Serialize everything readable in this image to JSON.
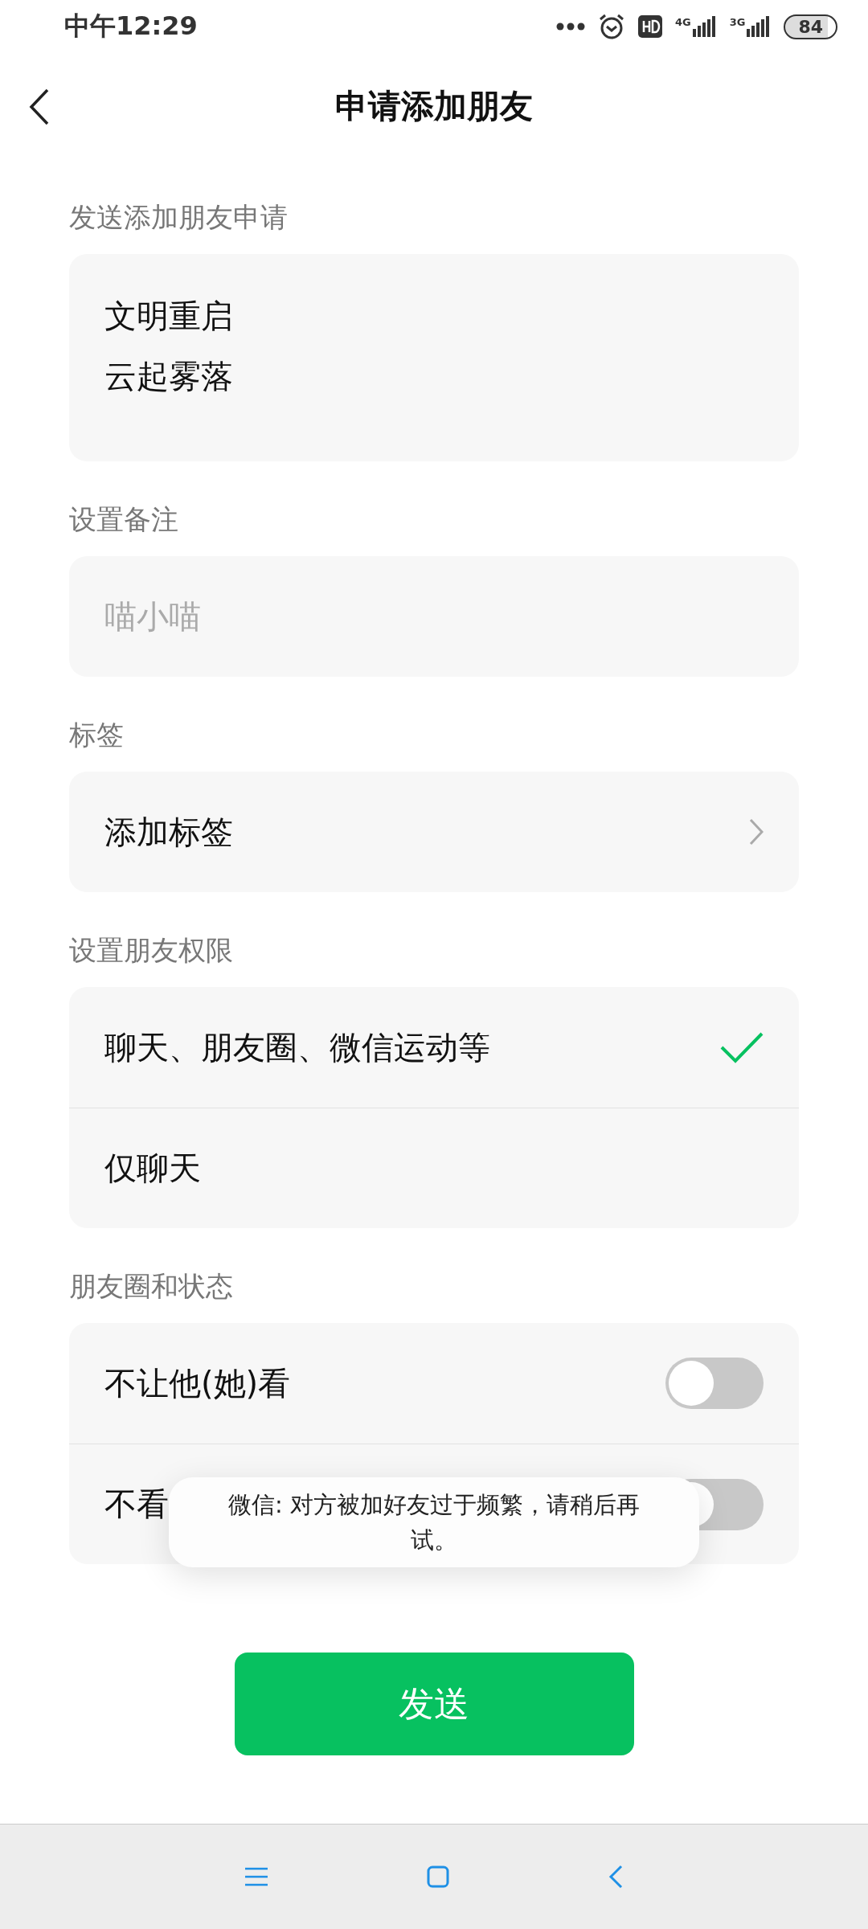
{
  "status_bar": {
    "time": "中午12:29",
    "network_1": "4G",
    "network_2": "3G",
    "battery": "84"
  },
  "header": {
    "title": "申请添加朋友"
  },
  "sections": [
    {
      "kind": "textarea",
      "label": "发送添加朋友申请",
      "lines": [
        "文明重启",
        "云起雾落"
      ]
    },
    {
      "kind": "input",
      "label": "设置备注",
      "placeholder": "喵小喵"
    },
    {
      "kind": "link",
      "label": "标签",
      "text": "添加标签"
    },
    {
      "kind": "choice",
      "label": "设置朋友权限",
      "options": [
        {
          "text": "聊天、朋友圈、微信运动等",
          "selected": true
        },
        {
          "text": "仅聊天",
          "selected": false
        }
      ]
    },
    {
      "kind": "switches",
      "label": "朋友圈和状态",
      "options": [
        {
          "text": "不让他(她)看",
          "on": false
        },
        {
          "text": "不看",
          "on": false
        }
      ]
    }
  ],
  "toast": "微信: 对方被加好友过于频繁，请稍后再试。",
  "send_button": "发送"
}
